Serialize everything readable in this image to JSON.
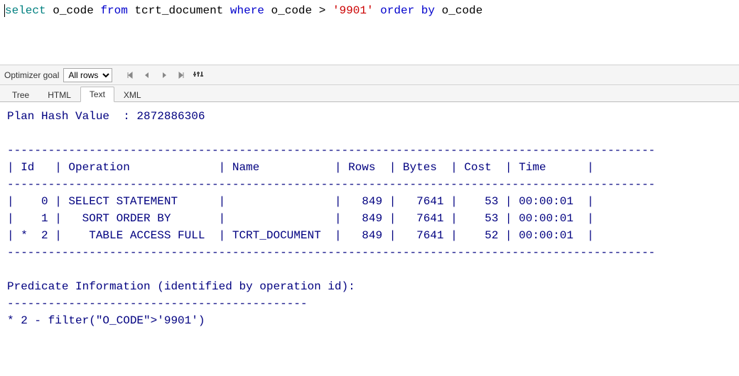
{
  "sql": {
    "tokens": [
      {
        "text": "select",
        "cls": "kw-select"
      },
      {
        "text": " ",
        "cls": ""
      },
      {
        "text": "o_code",
        "cls": "kw-ident"
      },
      {
        "text": " ",
        "cls": ""
      },
      {
        "text": "from",
        "cls": "kw-blue"
      },
      {
        "text": " ",
        "cls": ""
      },
      {
        "text": "tcrt_document",
        "cls": "kw-ident"
      },
      {
        "text": " ",
        "cls": ""
      },
      {
        "text": "where",
        "cls": "kw-blue"
      },
      {
        "text": " ",
        "cls": ""
      },
      {
        "text": "o_code",
        "cls": "kw-ident"
      },
      {
        "text": " ",
        "cls": ""
      },
      {
        "text": ">",
        "cls": "kw-ident"
      },
      {
        "text": " ",
        "cls": ""
      },
      {
        "text": "'9901'",
        "cls": "kw-str"
      },
      {
        "text": " ",
        "cls": ""
      },
      {
        "text": "order by",
        "cls": "kw-blue"
      },
      {
        "text": " ",
        "cls": ""
      },
      {
        "text": "o_code",
        "cls": "kw-ident"
      }
    ]
  },
  "toolbar": {
    "optimizer_label": "Optimizer goal",
    "optimizer_value": "All rows"
  },
  "tabs": [
    {
      "label": "Tree",
      "active": false
    },
    {
      "label": "HTML",
      "active": false
    },
    {
      "label": "Text",
      "active": true
    },
    {
      "label": "XML",
      "active": false
    }
  ],
  "plan": {
    "hash_label": "Plan Hash Value  :",
    "hash_value": "2872886306",
    "columns": [
      "Id",
      "Operation",
      "Name",
      "Rows",
      "Bytes",
      "Cost",
      "Time"
    ],
    "rows": [
      {
        "id": "0",
        "star": false,
        "op": "SELECT STATEMENT",
        "name": "",
        "rows": "849",
        "bytes": "7641",
        "cost": "53",
        "time": "00:00:01"
      },
      {
        "id": "1",
        "star": false,
        "op": "  SORT ORDER BY",
        "name": "",
        "rows": "849",
        "bytes": "7641",
        "cost": "53",
        "time": "00:00:01"
      },
      {
        "id": "2",
        "star": true,
        "op": "   TABLE ACCESS FULL",
        "name": "TCRT_DOCUMENT",
        "rows": "849",
        "bytes": "7641",
        "cost": "52",
        "time": "00:00:01"
      }
    ],
    "predicate_header": "Predicate Information (identified by operation id):",
    "predicate_lines": [
      "* 2 - filter(\"O_CODE\">'9901')"
    ]
  }
}
